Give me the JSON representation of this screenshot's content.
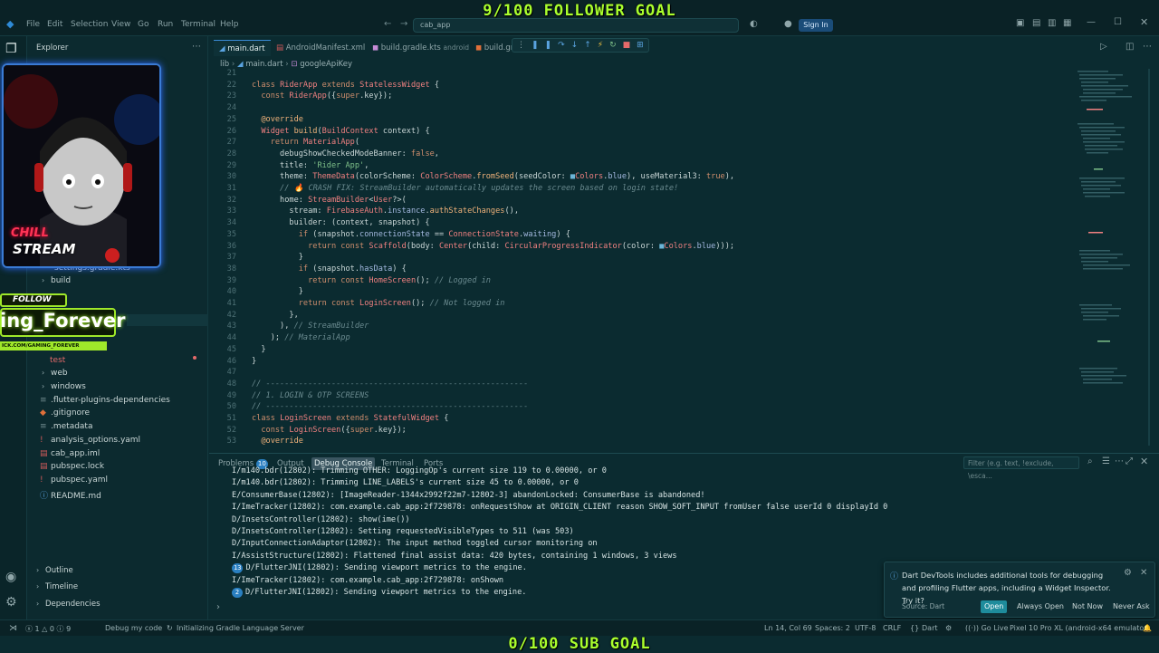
{
  "titlebar": {
    "menus": [
      "File",
      "Edit",
      "Selection",
      "View",
      "Go",
      "Run",
      "Terminal",
      "Help"
    ],
    "command_center": "cab_app",
    "signin_label": "Sign In"
  },
  "overlay": {
    "follower_goal": "9/100 FOLLOWER GOAL",
    "sub_goal": "0/100 SUB GOAL",
    "follow_label": "FOLLOW",
    "channel_name": "ing_Forever",
    "channel_url": "ICK.COM/GAMING_FOREVER",
    "webcam_text1": "CHILL",
    "webcam_text2": "STREAM"
  },
  "sidebar": {
    "title": "Explorer",
    "items": [
      {
        "label": "settings.gradle.kts",
        "type": "file"
      },
      {
        "label": "build",
        "type": "folder"
      },
      {
        "label": "test",
        "type": "folder"
      },
      {
        "label": "web",
        "type": "folder"
      },
      {
        "label": "windows",
        "type": "folder"
      },
      {
        "label": ".flutter-plugins-dependencies",
        "type": "file"
      },
      {
        "label": ".gitignore",
        "type": "file"
      },
      {
        "label": ".metadata",
        "type": "file"
      },
      {
        "label": "analysis_options.yaml",
        "type": "file"
      },
      {
        "label": "cab_app.iml",
        "type": "file"
      },
      {
        "label": "pubspec.lock",
        "type": "file"
      },
      {
        "label": "pubspec.yaml",
        "type": "file"
      },
      {
        "label": "README.md",
        "type": "file"
      }
    ],
    "sections": [
      "Outline",
      "Timeline",
      "Dependencies"
    ]
  },
  "tabs": [
    {
      "label": "main.dart",
      "active": true
    },
    {
      "label": "AndroidManifest.xml",
      "active": false
    },
    {
      "label": "build.gradle.kts",
      "suffix": "android",
      "active": false
    },
    {
      "label": "build.gr...",
      "active": false
    }
  ],
  "breadcrumb": [
    "lib",
    "main.dart",
    "googleApiKey"
  ],
  "code": [
    {
      "n": "21",
      "html": ""
    },
    {
      "n": "22",
      "html": "<span class=\"kw\">class</span> <span class=\"cls\">RiderApp</span> <span class=\"kw\">extends</span> <span class=\"cls\">StatelessWidget</span> {"
    },
    {
      "n": "23",
      "html": "  <span class=\"kw\">const</span> <span class=\"cls\">RiderApp</span>({<span class=\"kw\">super</span>.key});"
    },
    {
      "n": "24",
      "html": ""
    },
    {
      "n": "25",
      "html": "  <span class=\"fn\">@override</span>"
    },
    {
      "n": "26",
      "html": "  <span class=\"cls\">Widget</span> <span class=\"fn\">build</span>(<span class=\"cls\">BuildContext</span> context) {"
    },
    {
      "n": "27",
      "html": "    <span class=\"kw\">return</span> <span class=\"cls\">MaterialApp</span>("
    },
    {
      "n": "28",
      "html": "      debugShowCheckedModeBanner: <span class=\"kw\">false</span>,"
    },
    {
      "n": "29",
      "html": "      title: <span class=\"str\">'Rider App'</span>,"
    },
    {
      "n": "30",
      "html": "      theme: <span class=\"cls\">ThemeData</span>(colorScheme: <span class=\"cls\">ColorScheme</span>.<span class=\"fn\">fromSeed</span>(seedColor: <span class=\"num\">■</span><span class=\"cls\">Colors</span>.<span class=\"prop\">blue</span>), useMaterial3: <span class=\"kw\">true</span>),"
    },
    {
      "n": "31",
      "html": "      <span class=\"cm\">// 🔥 CRASH FIX: StreamBuilder automatically updates the screen based on login state!</span>"
    },
    {
      "n": "32",
      "html": "      home: <span class=\"cls\">StreamBuilder</span>&lt;<span class=\"cls\">User</span>?&gt;("
    },
    {
      "n": "33",
      "html": "        stream: <span class=\"cls\">FirebaseAuth</span>.<span class=\"prop\">instance</span>.<span class=\"fn\">authStateChanges</span>(),"
    },
    {
      "n": "34",
      "html": "        builder: (context, snapshot) {"
    },
    {
      "n": "35",
      "html": "          <span class=\"kw\">if</span> (snapshot.<span class=\"prop\">connectionState</span> == <span class=\"cls\">ConnectionState</span>.<span class=\"prop\">waiting</span>) {"
    },
    {
      "n": "36",
      "html": "            <span class=\"kw\">return const</span> <span class=\"cls\">Scaffold</span>(body: <span class=\"cls\">Center</span>(child: <span class=\"cls\">CircularProgressIndicator</span>(color: <span class=\"num\">■</span><span class=\"cls\">Colors</span>.<span class=\"prop\">blue</span>)));"
    },
    {
      "n": "37",
      "html": "          }"
    },
    {
      "n": "38",
      "html": "          <span class=\"kw\">if</span> (snapshot.<span class=\"prop\">hasData</span>) {"
    },
    {
      "n": "39",
      "html": "            <span class=\"kw\">return const</span> <span class=\"cls\">HomeScreen</span>(); <span class=\"cm\">// Logged in</span>"
    },
    {
      "n": "40",
      "html": "          }"
    },
    {
      "n": "41",
      "html": "          <span class=\"kw\">return const</span> <span class=\"cls\">LoginScreen</span>(); <span class=\"cm\">// Not logged in</span>"
    },
    {
      "n": "42",
      "html": "        },"
    },
    {
      "n": "43",
      "html": "      ), <span class=\"cm\">// StreamBuilder</span>"
    },
    {
      "n": "44",
      "html": "    ); <span class=\"cm\">// MaterialApp</span>"
    },
    {
      "n": "45",
      "html": "  }"
    },
    {
      "n": "46",
      "html": "}"
    },
    {
      "n": "47",
      "html": ""
    },
    {
      "n": "48",
      "html": "<span class=\"cm\">// --------------------------------------------------------</span>"
    },
    {
      "n": "49",
      "html": "<span class=\"cm\">// 1. LOGIN &amp; OTP SCREENS</span>"
    },
    {
      "n": "50",
      "html": "<span class=\"cm\">// --------------------------------------------------------</span>"
    },
    {
      "n": "51",
      "html": "<span class=\"kw\">class</span> <span class=\"cls\">LoginScreen</span> <span class=\"kw\">extends</span> <span class=\"cls\">StatefulWidget</span> {"
    },
    {
      "n": "52",
      "html": "  <span class=\"kw\">const</span> <span class=\"cls\">LoginScreen</span>({<span class=\"kw\">super</span>.key});"
    },
    {
      "n": "53",
      "html": "  <span class=\"fn\">@override</span>"
    }
  ],
  "panel": {
    "tabs": [
      {
        "label": "Problems",
        "badge": "10"
      },
      {
        "label": "Output"
      },
      {
        "label": "Debug Console",
        "active": true
      },
      {
        "label": "Terminal"
      },
      {
        "label": "Ports"
      }
    ],
    "filter_placeholder": "Filter (e.g. text, !exclude, \\esca...",
    "logs": [
      {
        "badge": "",
        "text": "I/m140.bdr(12802): Trimming OTHER: LoggingOp's current size 119 to 0.00000, or 0"
      },
      {
        "badge": "",
        "text": "I/m140.bdr(12802): Trimming LINE_LABELS's current size 45 to 0.00000, or 0"
      },
      {
        "badge": "",
        "text": "E/ConsumerBase(12802): [ImageReader-1344x2992f22m7-12802-3] abandonLocked: ConsumerBase is abandoned!"
      },
      {
        "badge": "",
        "text": "I/ImeTracker(12802): com.example.cab_app:2f729878: onRequestShow at ORIGIN_CLIENT reason SHOW_SOFT_INPUT fromUser false userId 0 displayId 0"
      },
      {
        "badge": "",
        "text": "D/InsetsController(12802): show(ime())"
      },
      {
        "badge": "",
        "text": "D/InsetsController(12802): Setting requestedVisibleTypes to 511 (was 503)"
      },
      {
        "badge": "",
        "text": "D/InputConnectionAdaptor(12802): The input method toggled cursor monitoring on"
      },
      {
        "badge": "",
        "text": "I/AssistStructure(12802): Flattened final assist data: 420 bytes, containing 1 windows, 3 views"
      },
      {
        "badge": "13",
        "text": "D/FlutterJNI(12802): Sending viewport metrics to the engine."
      },
      {
        "badge": "",
        "text": "I/ImeTracker(12802): com.example.cab_app:2f729878: onShown"
      },
      {
        "badge": "2",
        "text": "D/FlutterJNI(12802): Sending viewport metrics to the engine."
      }
    ]
  },
  "notification": {
    "message": "Dart DevTools includes additional tools for debugging and profiling Flutter apps, including a Widget Inspector. Try it?",
    "source": "Source: Dart",
    "buttons": [
      "Open",
      "Always Open",
      "Not Now",
      "Never Ask"
    ]
  },
  "statusbar": {
    "errors": "1",
    "warnings": "0",
    "infos": "9",
    "debug": "Debug my code",
    "task": "Initializing Gradle Language Server",
    "position": "Ln 14, Col 69",
    "spaces": "Spaces: 2",
    "encoding": "UTF-8",
    "eol": "CRLF",
    "language": "Dart",
    "golive": "Go Live",
    "device": "Pixel 10 Pro XL (android-x64 emulator)"
  },
  "colors": {
    "background": "#0b2b30",
    "accent": "#aaff2e",
    "button": "#2a7fc0"
  }
}
